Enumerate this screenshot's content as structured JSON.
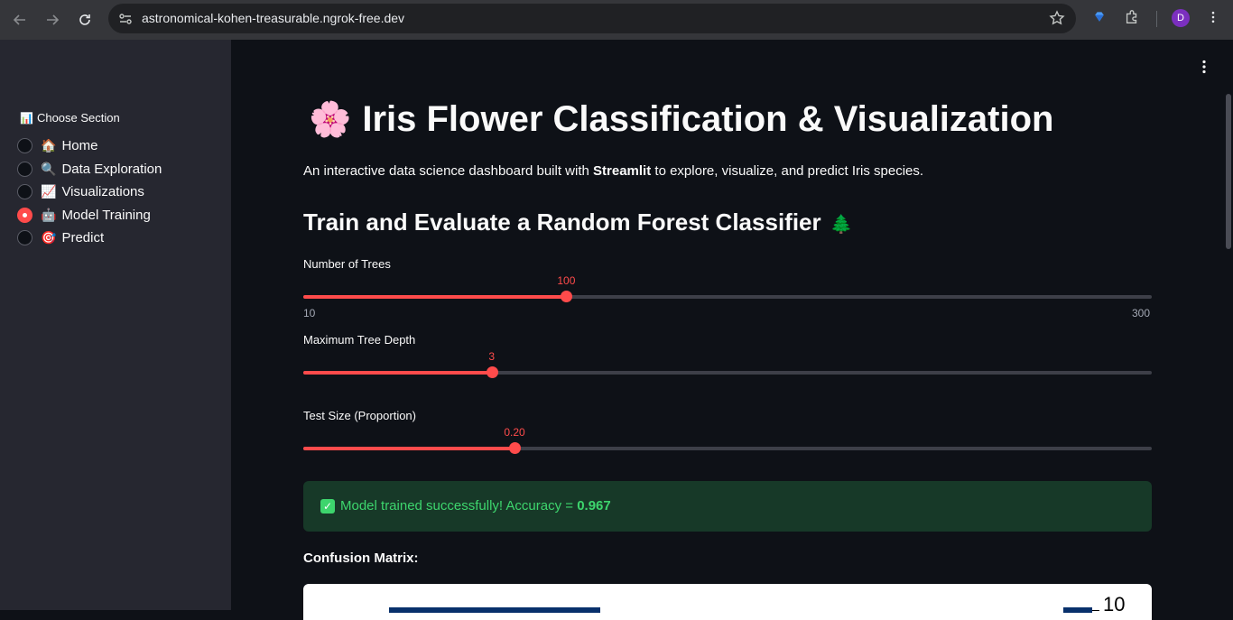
{
  "browser": {
    "url": "astronomical-kohen-treasurable.ngrok-free.dev",
    "avatar_letter": "D"
  },
  "sidebar": {
    "title": "Choose Section",
    "title_emoji": "📊",
    "items": [
      {
        "emoji": "🏠",
        "label": "Home",
        "selected": false
      },
      {
        "emoji": "🔍",
        "label": "Data Exploration",
        "selected": false
      },
      {
        "emoji": "📈",
        "label": "Visualizations",
        "selected": false
      },
      {
        "emoji": "🤖",
        "label": "Model Training",
        "selected": true
      },
      {
        "emoji": "🎯",
        "label": "Predict",
        "selected": false
      }
    ]
  },
  "main": {
    "title_emoji": "🌸",
    "title": "Iris Flower Classification & Visualization",
    "subtitle_prefix": "An interactive data science dashboard built with ",
    "subtitle_bold": "Streamlit",
    "subtitle_suffix": " to explore, visualize, and predict Iris species.",
    "section_title": "Train and Evaluate a Random Forest Classifier",
    "section_emoji": "🌲",
    "sliders": [
      {
        "label": "Number of Trees",
        "value": "100",
        "min": "10",
        "max": "300",
        "fraction": 0.31
      },
      {
        "label": "Maximum Tree Depth",
        "value": "3",
        "fraction": 0.222
      },
      {
        "label": "Test Size (Proportion)",
        "value": "0.20",
        "fraction": 0.249
      }
    ],
    "success": {
      "prefix": "Model trained successfully! Accuracy = ",
      "accuracy": "0.967"
    },
    "confusion_label": "Confusion Matrix:",
    "colorbar_top_value": "10"
  },
  "colors": {
    "accent": "#ff4b4b",
    "success_text": "#3dd56d",
    "success_bg": "#173928",
    "sidebar_bg": "#262730",
    "main_bg": "#0e1117"
  }
}
